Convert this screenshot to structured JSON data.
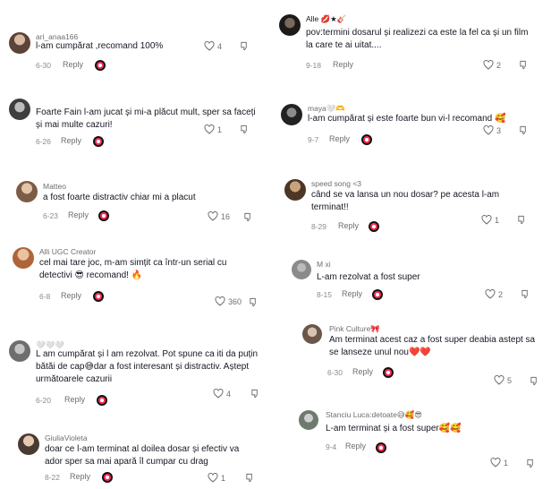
{
  "comments": [
    {
      "username": "ari_anaa166",
      "text": "l-am cumpărat ,recomand 100%",
      "date": "6-30",
      "reply": "Reply",
      "likes": "4"
    },
    {
      "username": "",
      "text": "Foarte Fain l-am jucat și mi-a plăcut mult, sper sa faceți și mai multe cazuri!",
      "date": "6-26",
      "reply": "Reply",
      "likes": "1"
    },
    {
      "username": "Matteo",
      "text": "a fost foarte distractiv chiar mi a placut",
      "date": "6-23",
      "reply": "Reply",
      "likes": "16"
    },
    {
      "username": "Alli UGC Creator",
      "text": "cel mai tare joc, m-am simțit ca într-un serial cu detectivi 😎 recomand! 🔥",
      "date": "6-8",
      "reply": "Reply",
      "likes": "360"
    },
    {
      "username": "🤍🤍🤍",
      "text": "L am cumpărat și l am rezolvat. Pot spune ca iti da puțin bătăi de cap😅dar a fost interesant și distractiv. Aștept următoarele cazurii",
      "date": "6-20",
      "reply": "Reply",
      "likes": "4"
    },
    {
      "username": "GiuliaVioleta",
      "text": "doar ce l-am terminat al doilea dosar și efectiv va ador sper sa mai apară îl cumpar cu drag",
      "date": "8-22",
      "reply": "Reply",
      "likes": "1"
    },
    {
      "username": "Alle 💋★🎸",
      "text": "pov:termini dosarul și realizezi ca este la fel ca și un film la care te ai uitat....",
      "date": "9-18",
      "reply": "Reply",
      "likes": "2"
    },
    {
      "username": "maya🤍🫶",
      "text": "l-am cumpărat și este foarte bun vi-l recomand 🥰",
      "date": "9-7",
      "reply": "Reply",
      "likes": "3"
    },
    {
      "username": "speed song <3",
      "text": "când se va lansa un nou dosar? pe acesta l-am terminat!!",
      "date": "8-29",
      "reply": "Reply",
      "likes": "1"
    },
    {
      "username": "M xi",
      "text": "L-am rezolvat a fost super",
      "date": "8-15",
      "reply": "Reply",
      "likes": "2"
    },
    {
      "username": "Pink Culture🎀",
      "text": "Am terminat acest caz a fost super deabia astept sa se lanseze unul nou❤️❤️",
      "date": "6-30",
      "reply": "Reply",
      "likes": "5"
    },
    {
      "username": "Stanciu Luca:detoate😅🥰😎",
      "text": "L-am terminat și a fost super🥰🥰",
      "date": "9-4",
      "reply": "Reply",
      "likes": "1"
    }
  ],
  "colors": {
    "accent": "#fe2c55",
    "text": "#161823",
    "muted": "#8a8b91"
  }
}
